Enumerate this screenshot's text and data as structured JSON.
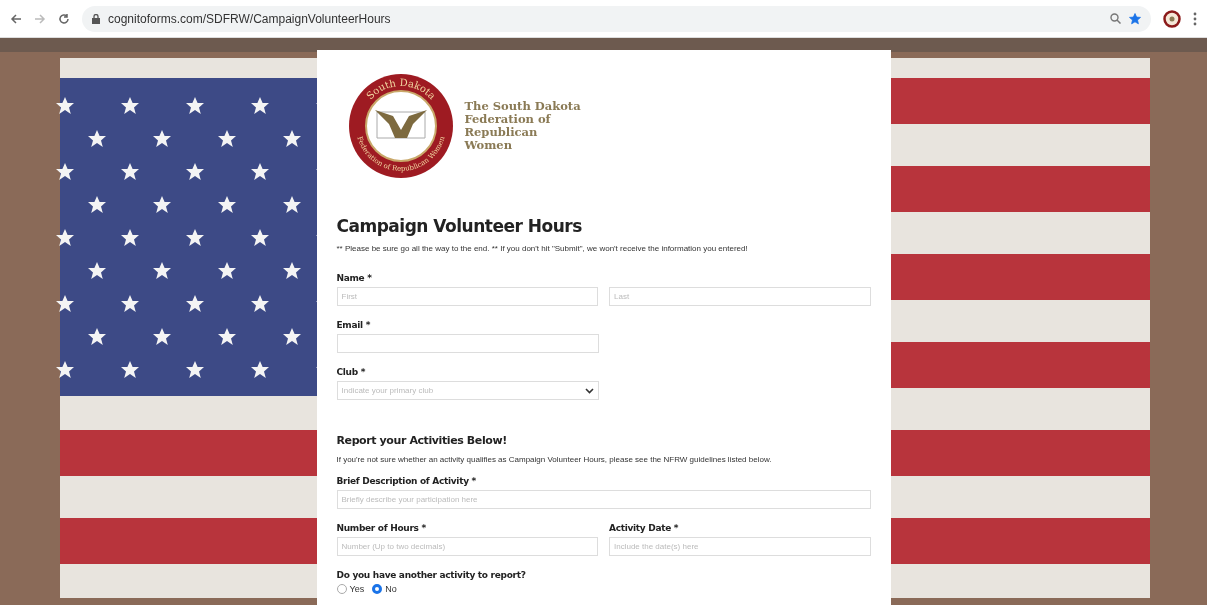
{
  "browser": {
    "url": "cognitoforms.com/SDFRW/CampaignVolunteerHours",
    "bookmarked": true
  },
  "logo": {
    "seal_top": "South Dakota",
    "seal_bottom": "Federation of Republican Women",
    "name_lines": [
      "The South Dakota",
      "Federation of",
      "Republican",
      "Women"
    ]
  },
  "form": {
    "title": "Campaign Volunteer Hours",
    "note": "** Please be sure go all the way to the end. ** If you don't hit \"Submit\", we won't receive the information you entered!",
    "fields": [
      {
        "kind": "pair",
        "label": "Name",
        "required": "*",
        "placeholders": [
          "First",
          "Last"
        ]
      },
      {
        "kind": "text",
        "label": "Email",
        "required": "*"
      },
      {
        "kind": "select",
        "label": "Club",
        "required": "*",
        "placeholder": "Indicate your primary club"
      }
    ],
    "section": {
      "title": "Report your Activities Below!",
      "text": "If you're not sure whether an activity qualifies as Campaign Volunteer Hours, please see the NFRW guidelines listed below."
    },
    "activity_fields": [
      {
        "kind": "wide",
        "label": "Brief Description of Activity",
        "required": "*",
        "placeholder": "Briefly describe your participation here"
      },
      {
        "kind": "split",
        "items": [
          {
            "label": "Number of Hours",
            "required": "*",
            "placeholder": "Number (Up to two decimals)"
          },
          {
            "label": "Activity Date",
            "required": "*",
            "placeholder": "Include the date(s) here"
          }
        ]
      }
    ],
    "question": {
      "label": "Do you have another activity to report?",
      "options": [
        {
          "label": "Yes",
          "selected": false
        },
        {
          "label": "No",
          "selected": true
        }
      ]
    }
  }
}
